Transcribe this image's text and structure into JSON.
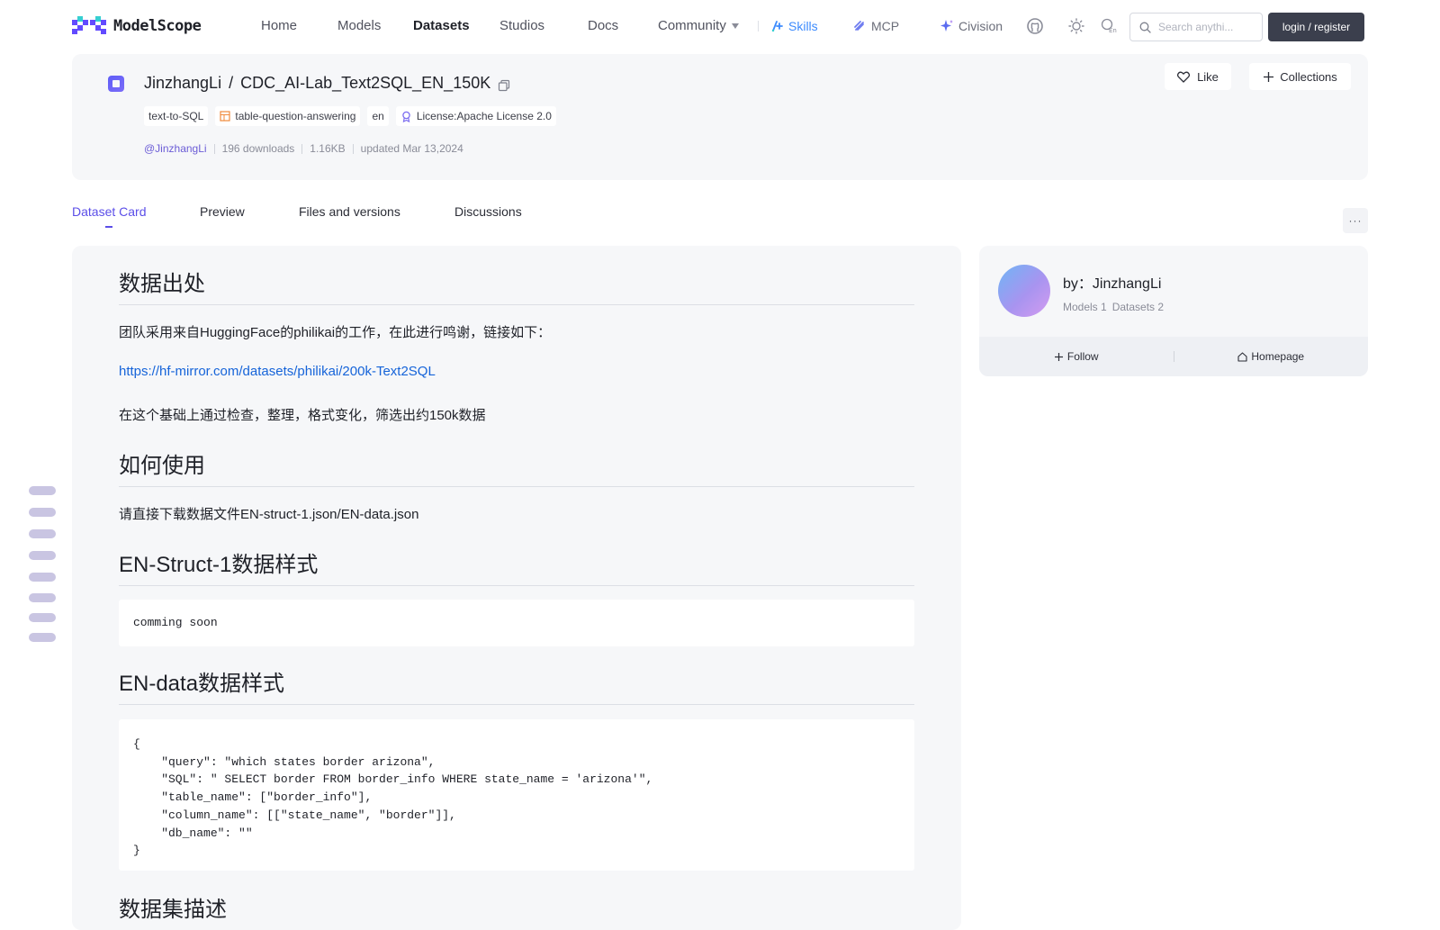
{
  "nav": {
    "logo_text": "ModelScope",
    "items": [
      {
        "label": "Home"
      },
      {
        "label": "Models"
      },
      {
        "label": "Datasets"
      },
      {
        "label": "Studios"
      },
      {
        "label": "Docs"
      },
      {
        "label": "Community"
      }
    ],
    "active_item": "Datasets",
    "features": [
      {
        "label": "Skills",
        "icon": "skills-icon",
        "color": "#3d8bfd"
      },
      {
        "label": "MCP",
        "icon": "mcp-icon",
        "color": "#6b6e7a"
      },
      {
        "label": "Civision",
        "icon": "sparkle-icon",
        "color": "#6b6e7a"
      }
    ],
    "search_placeholder": "Search anythi...",
    "login_label": "login / register"
  },
  "dataset": {
    "owner": "JinzhangLi",
    "separator": "/",
    "name": "CDC_AI-Lab_Text2SQL_EN_150K",
    "tags": [
      {
        "label": "text-to-SQL",
        "icon": ""
      },
      {
        "label": "table-question-answering",
        "icon": "table-icon"
      },
      {
        "label": "en",
        "icon": ""
      },
      {
        "label": "License:Apache License 2.0",
        "icon": "license-icon"
      }
    ],
    "author_handle": "@JinzhangLi",
    "downloads": "196 downloads",
    "size": "1.16KB",
    "updated": "updated Mar 13,2024",
    "like_label": "Like",
    "collections_label": "Collections"
  },
  "tabs": [
    {
      "label": "Dataset Card",
      "active": true
    },
    {
      "label": "Preview",
      "active": false
    },
    {
      "label": "Files and versions",
      "active": false
    },
    {
      "label": "Discussions",
      "active": false
    }
  ],
  "more_label": "···",
  "card": {
    "h_source": "数据出处",
    "p_thanks": "团队采用来自HuggingFace的philikai的工作，在此进行鸣谢，链接如下：",
    "link": "https://hf-mirror.com/datasets/philikai/200k-Text2SQL",
    "p_filter": "在这个基础上通过检查，整理，格式变化，筛选出约150k数据",
    "h_usage": "如何使用",
    "p_download": "请直接下载数据文件EN-struct-1.json/EN-data.json",
    "h_struct": "EN-Struct-1数据样式",
    "code_struct": "comming soon",
    "h_data": "EN-data数据样式",
    "code_data": "{\n    \"query\": \"which states border arizona\",\n    \"SQL\": \" SELECT border FROM border_info WHERE state_name = 'arizona'\",\n    \"table_name\": [\"border_info\"],\n    \"column_name\": [[\"state_name\", \"border\"]],\n    \"db_name\": \"\"\n}",
    "h_next_partial": "数据集描述"
  },
  "author_card": {
    "by_label": "by：JinzhangLi",
    "models": "Models 1",
    "datasets": "Datasets 2",
    "follow_label": "Follow",
    "homepage_label": "Homepage"
  },
  "colors": {
    "accent": "#5b4ee8",
    "link": "#1664d9",
    "panel_bg": "#f6f7f9",
    "login_bg": "#3b3f4d"
  }
}
